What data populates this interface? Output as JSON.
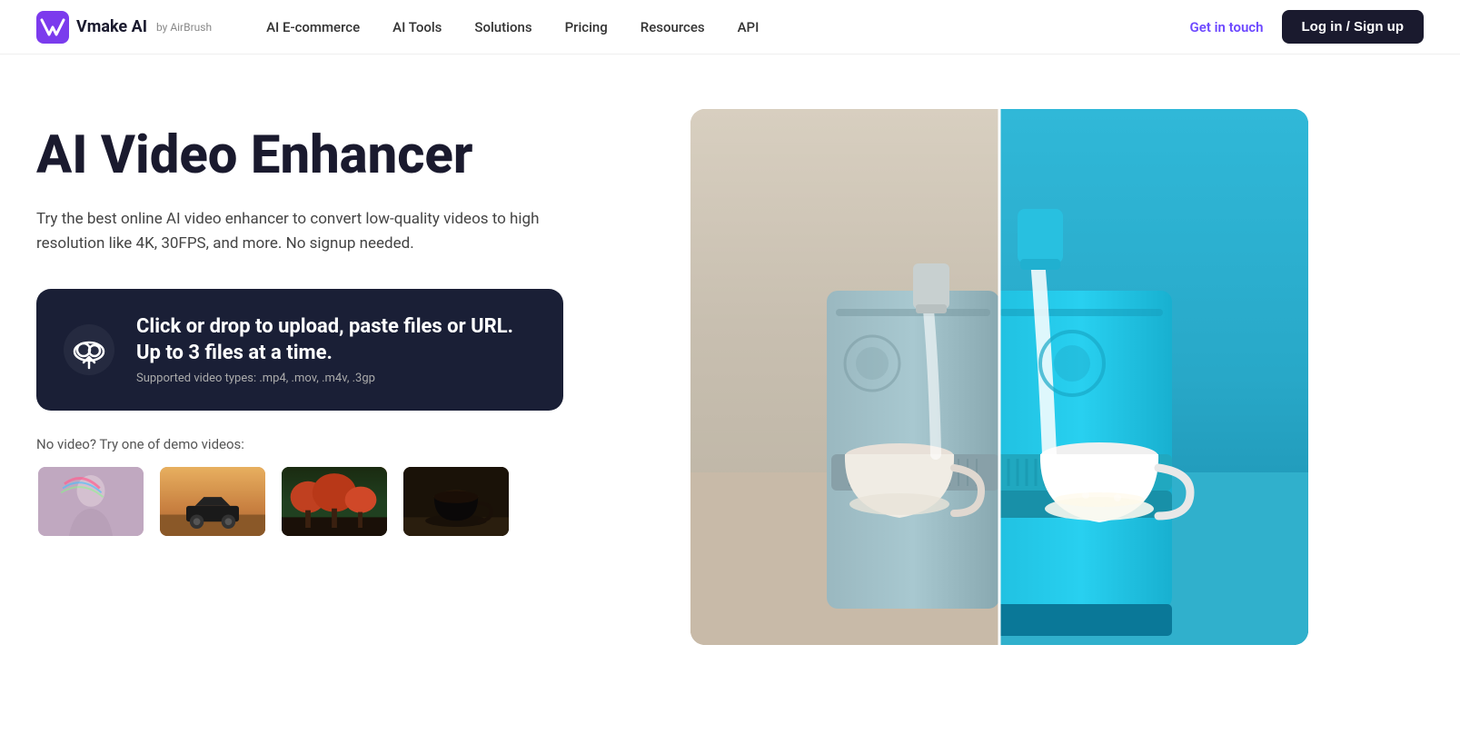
{
  "header": {
    "logo_text": "Vmake AI",
    "logo_by": "by AirBrush",
    "nav_items": [
      {
        "label": "AI E-commerce",
        "id": "ai-ecommerce"
      },
      {
        "label": "AI Tools",
        "id": "ai-tools"
      },
      {
        "label": "Solutions",
        "id": "solutions"
      },
      {
        "label": "Pricing",
        "id": "pricing"
      },
      {
        "label": "Resources",
        "id": "resources"
      },
      {
        "label": "API",
        "id": "api"
      }
    ],
    "get_in_touch": "Get in touch",
    "login_label": "Log in / Sign up"
  },
  "hero": {
    "title": "AI Video Enhancer",
    "subtitle": "Try the best online AI video enhancer to convert low-quality videos to high resolution like 4K, 30FPS, and more. No signup needed."
  },
  "upload": {
    "main_text": "Click or drop to upload, paste files or URL. Up to 3 files at a time.",
    "sub_text": "Supported video types: .mp4, .mov, .m4v, .3gp"
  },
  "demo": {
    "label": "No video? Try one of demo videos:",
    "thumbnails": [
      {
        "id": "thumb-person",
        "alt": "Person with rainbow light"
      },
      {
        "id": "thumb-car",
        "alt": "Car in desert"
      },
      {
        "id": "thumb-nature",
        "alt": "Nature landscape"
      },
      {
        "id": "thumb-coffee",
        "alt": "Coffee cup"
      }
    ]
  }
}
